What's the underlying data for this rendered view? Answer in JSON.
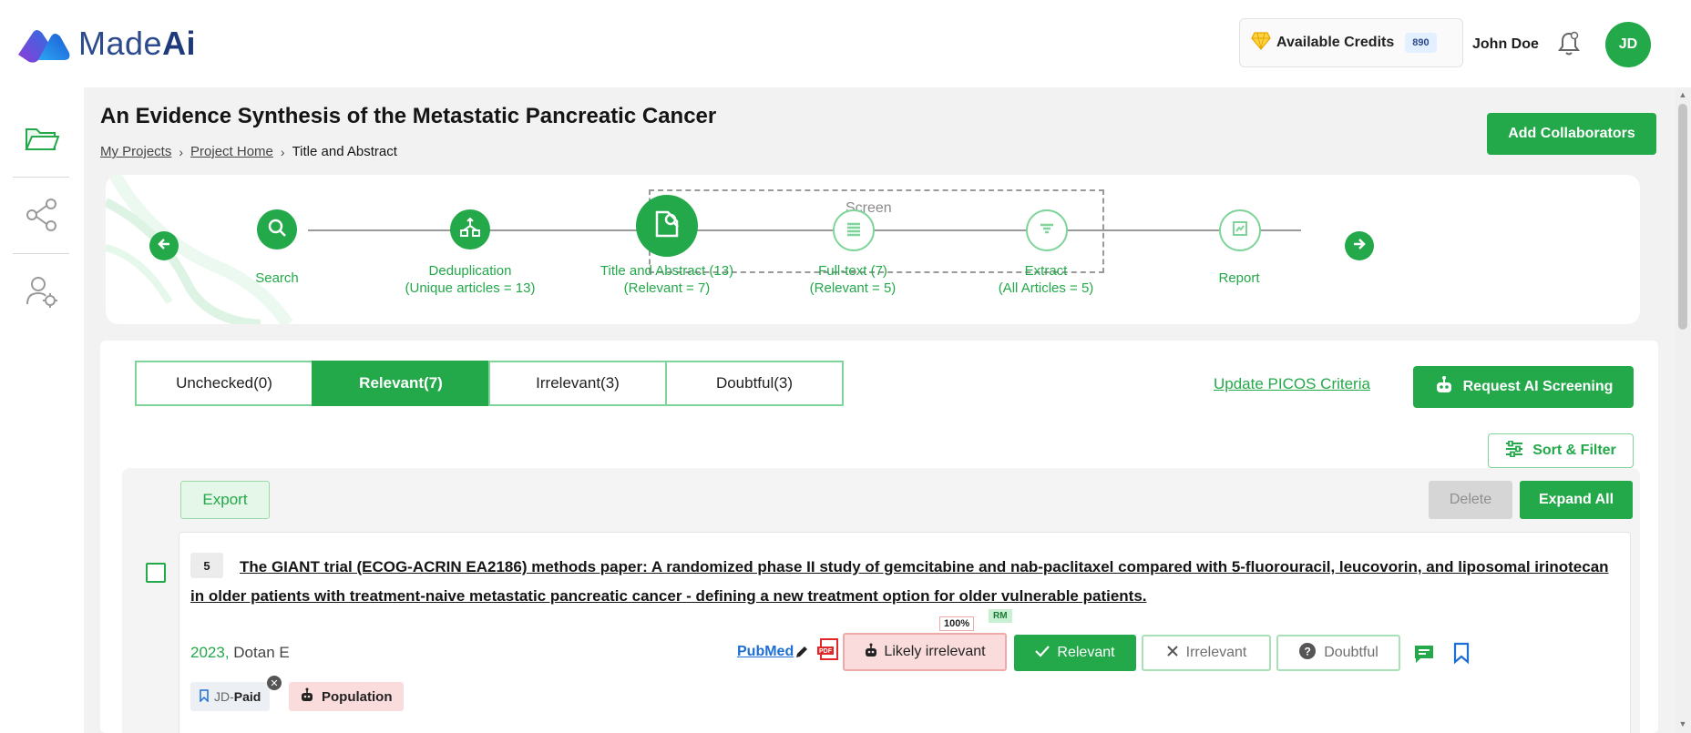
{
  "header": {
    "logo_text_light": "Made",
    "logo_text_bold": "Ai",
    "credits_label": "Available Credits",
    "credits_count": "890",
    "user_name": "John Doe",
    "avatar_initials": "JD"
  },
  "sidebar": {
    "items": [
      {
        "name": "projects",
        "icon": "folder-icon"
      },
      {
        "name": "share",
        "icon": "share-icon"
      },
      {
        "name": "user-settings",
        "icon": "user-settings-icon"
      }
    ]
  },
  "page": {
    "title": "An Evidence Synthesis of the Metastatic Pancreatic Cancer",
    "breadcrumb": [
      "My Projects",
      "Project Home",
      "Title and Abstract"
    ],
    "add_collaborators_label": "Add Collaborators"
  },
  "stepper": {
    "screen_label": "Screen",
    "steps": [
      {
        "label": "Search",
        "sub": "",
        "icon": "search-icon",
        "style": "solid"
      },
      {
        "label": "Deduplication",
        "sub": "(Unique articles = 13)",
        "icon": "dedup-icon",
        "style": "solid"
      },
      {
        "label": "Title and Abstract (13)",
        "sub": "(Relevant = 7)",
        "icon": "screen-doc-icon",
        "style": "solid-large"
      },
      {
        "label": "Full-text (7)",
        "sub": "(Relevant = 5)",
        "icon": "list-icon",
        "style": "outline"
      },
      {
        "label": "Extract",
        "sub": "(All Articles = 5)",
        "icon": "filter-icon",
        "style": "outline"
      },
      {
        "label": "Report",
        "sub": "",
        "icon": "report-icon",
        "style": "outline"
      }
    ]
  },
  "tabs": [
    {
      "label": "Unchecked(0)",
      "active": false
    },
    {
      "label": "Relevant(7)",
      "active": true
    },
    {
      "label": "Irrelevant(3)",
      "active": false
    },
    {
      "label": "Doubtful(3)",
      "active": false
    }
  ],
  "actions": {
    "update_picos": "Update PICOS Criteria",
    "request_ai": "Request AI Screening",
    "sort_filter": "Sort & Filter",
    "export": "Export",
    "delete": "Delete",
    "expand_all": "Expand All"
  },
  "article": {
    "number": "5",
    "title": "The GIANT trial (ECOG-ACRIN EA2186) methods paper: A randomized phase II study of gemcitabine and nab-paclitaxel compared with 5-fluorouracil, leucovorin, and liposomal irinotecan in older patients with treatment-naive metastatic pancreatic cancer - defining a new treatment option for older vulnerable patients.",
    "year": "2023,",
    "author": "Dotan E",
    "source": "PubMed",
    "ai_label": "Likely irrelevant",
    "ai_percent": "100%",
    "rm_badge": "RM",
    "relevant_label": "Relevant",
    "irrelevant_label": "Irrelevant",
    "doubtful_label": "Doubtful",
    "tag_user": "JD-",
    "tag_kind": "Paid",
    "population_tag": "Population"
  },
  "colors": {
    "accent": "#23a84a",
    "accent_light": "#7fd49a",
    "danger_light": "#fbdcdc",
    "link_blue": "#1d6fd6"
  }
}
